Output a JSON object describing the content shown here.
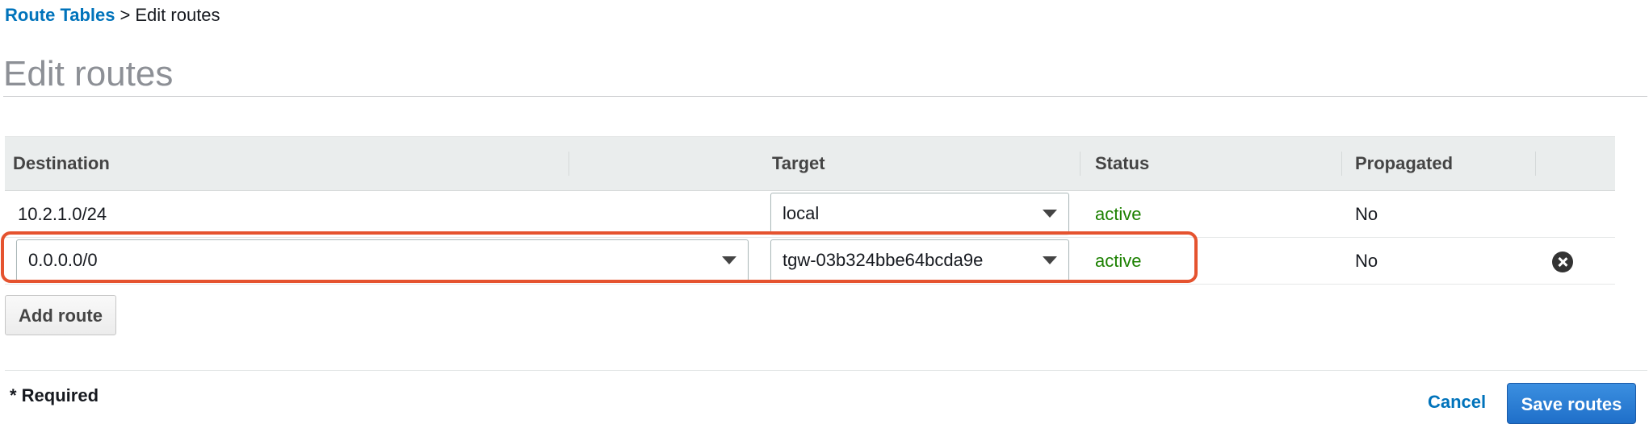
{
  "breadcrumb": {
    "parent": "Route Tables",
    "separator": ">",
    "current": "Edit routes"
  },
  "page_title": "Edit routes",
  "table": {
    "columns": [
      "Destination",
      "Target",
      "Status",
      "Propagated"
    ],
    "rows": [
      {
        "destination": "10.2.1.0/24",
        "destination_editable": false,
        "target": "local",
        "status": "active",
        "propagated": "No",
        "removable": false
      },
      {
        "destination": "0.0.0.0/0",
        "destination_editable": true,
        "target": "tgw-03b324bbe64bcda9e",
        "status": "active",
        "propagated": "No",
        "removable": true
      }
    ]
  },
  "buttons": {
    "add_route": "Add route",
    "cancel": "Cancel",
    "save_routes": "Save routes"
  },
  "required_note": "* Required",
  "icons": {
    "dropdown": "caret-down-icon",
    "remove": "remove-circle-icon"
  },
  "colors": {
    "link": "#0073bb",
    "status_active": "#1d8102",
    "primary_button": "#1f6fc9",
    "highlight": "#e5532f"
  }
}
